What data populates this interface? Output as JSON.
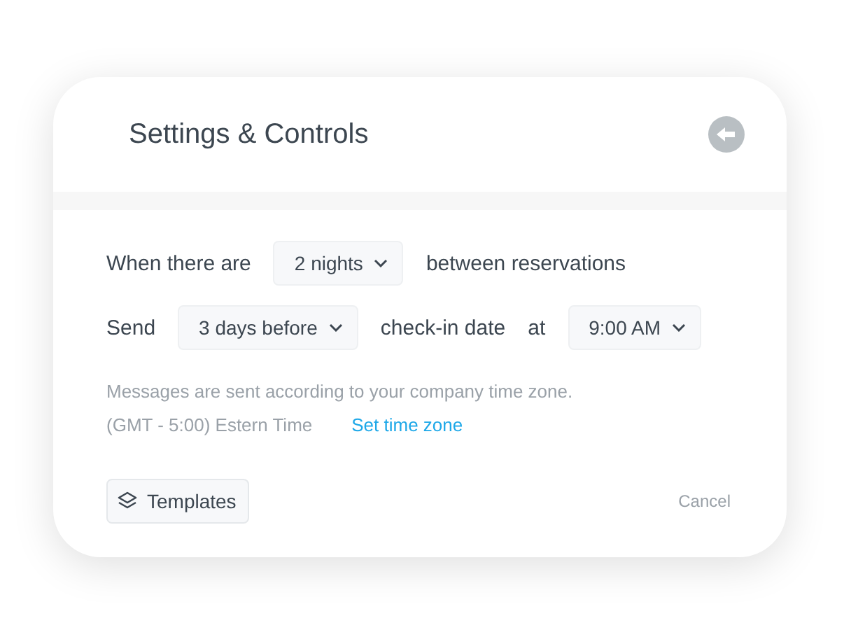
{
  "title": "Settings & Controls",
  "rows": [
    {
      "items": [
        {
          "kind": "text",
          "text": "When there are"
        },
        {
          "kind": "select",
          "value": "2 nights"
        },
        {
          "kind": "text",
          "text": "between reservations"
        }
      ]
    },
    {
      "items": [
        {
          "kind": "text",
          "text": "Send"
        },
        {
          "kind": "select",
          "value": "3 days before"
        },
        {
          "kind": "text",
          "text": "check-in date"
        },
        {
          "kind": "text",
          "text": "at"
        },
        {
          "kind": "select",
          "value": "9:00 AM"
        }
      ]
    }
  ],
  "note": "Messages are sent according to your company time zone.",
  "timezone": "(GMT - 5:00) Estern Time",
  "timezone_link": "Set time zone",
  "templates_button": "Templates",
  "cancel_button": "Cancel"
}
